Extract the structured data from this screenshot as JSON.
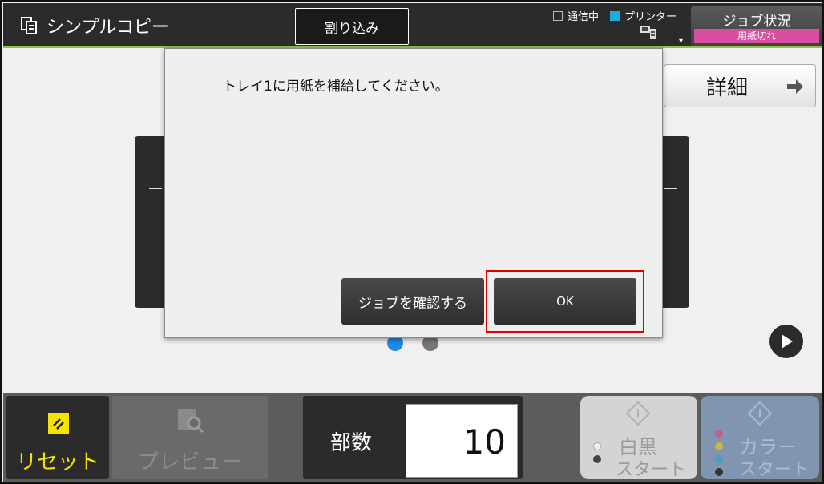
{
  "header": {
    "title": "シンプルコピー",
    "interrupt_label": "割り込み",
    "status": {
      "comm_label": "通信中",
      "printer_label": "プリンター",
      "dropdown_glyph": "▾"
    },
    "job_status": {
      "label": "ジョブ状況",
      "badge": "用紙切れ"
    }
  },
  "detail_button": {
    "label": "詳細"
  },
  "dialog": {
    "message": "トレイ1に用紙を補給してください。",
    "confirm_job_label": "ジョブを確認する",
    "ok_label": "OK"
  },
  "pager": {
    "current": 1,
    "total": 2
  },
  "footer": {
    "reset_label": "リセット",
    "preview_label": "プレビュー",
    "copies_label": "部数",
    "copies_value": "10",
    "bw_start": {
      "line1": "白黒",
      "line2": "スタート"
    },
    "color_start": {
      "line1": "カラー",
      "line2": "スタート"
    }
  },
  "colors": {
    "header_bg": "#2b2b2b",
    "header_accent": "#8bc34a",
    "badge": "#d84fa0",
    "reset_yellow": "#f5e400",
    "highlight_red": "#e00000",
    "pager_active": "#1e88e5"
  }
}
